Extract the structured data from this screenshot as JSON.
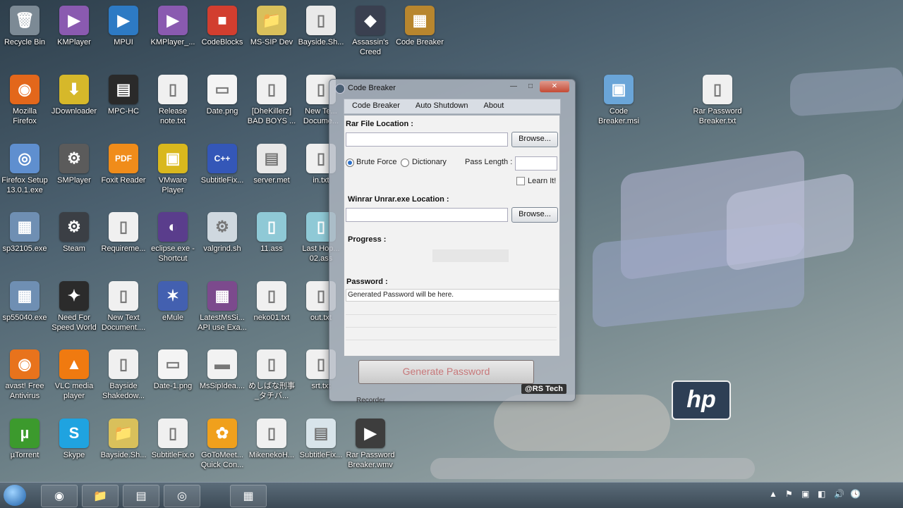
{
  "desktop_icons": [
    {
      "label": "Recycle Bin",
      "icon": "recycle-bin-icon",
      "color": "#7c8a95",
      "glyph": "🗑"
    },
    {
      "label": "KMPlayer",
      "icon": "kmplayer-icon",
      "color": "#8a5ab0",
      "glyph": "▶"
    },
    {
      "label": "MPUI",
      "icon": "mpui-icon",
      "color": "#2d7ac4",
      "glyph": "▶"
    },
    {
      "label": "KMPlayer_...",
      "icon": "kmplayer-icon",
      "color": "#8a5ab0",
      "glyph": "▶"
    },
    {
      "label": "CodeBlocks",
      "icon": "codeblocks-icon",
      "color": "#d23e2f",
      "glyph": "■"
    },
    {
      "label": "MS-SIP Dev",
      "icon": "folder-icon",
      "color": "#d9c05b",
      "glyph": "📁"
    },
    {
      "label": "Bayside.Sh...",
      "icon": "file-icon",
      "color": "#e9e9e9",
      "glyph": "▯"
    },
    {
      "label": "Assassin's Creed",
      "icon": "assassins-creed-icon",
      "color": "#3a4050",
      "glyph": "◆"
    },
    {
      "label": "Code Breaker",
      "icon": "winrar-icon",
      "color": "#b8862e",
      "glyph": "▦"
    },
    {
      "label": "Mozilla Firefox",
      "icon": "firefox-icon",
      "color": "#e3671b",
      "glyph": "◉"
    },
    {
      "label": "JDownloader",
      "icon": "jdownloader-icon",
      "color": "#d6b82a",
      "glyph": "⬇"
    },
    {
      "label": "MPC-HC",
      "icon": "mpc-hc-icon",
      "color": "#2a2a2a",
      "glyph": "▤"
    },
    {
      "label": "Release note.txt",
      "icon": "text-file-icon",
      "color": "#f0f0f0",
      "glyph": "▯"
    },
    {
      "label": "Date.png",
      "icon": "image-file-icon",
      "color": "#f4f4f4",
      "glyph": "▭"
    },
    {
      "label": "[DheKillerz] BAD BOYS ...",
      "icon": "file-icon",
      "color": "#f0f0f0",
      "glyph": "▯"
    },
    {
      "label": "New Te... Docume...",
      "icon": "text-file-icon",
      "color": "#f0f0f0",
      "glyph": "▯"
    },
    {
      "label": "Firefox Setup 13.0.1.exe",
      "icon": "installer-icon",
      "color": "#5f8fcf",
      "glyph": "◎"
    },
    {
      "label": "SMPlayer",
      "icon": "smplayer-icon",
      "color": "#5b5b5b",
      "glyph": "⚙"
    },
    {
      "label": "Foxit Reader",
      "icon": "foxit-reader-icon",
      "color": "#f08c1a",
      "glyph": "PDF"
    },
    {
      "label": "VMware Player",
      "icon": "vmware-icon",
      "color": "#d9b81d",
      "glyph": "▣"
    },
    {
      "label": "SubtitleFix...",
      "icon": "subtitle-fix-icon",
      "color": "#3457b8",
      "glyph": "C++"
    },
    {
      "label": "server.met",
      "icon": "server-file-icon",
      "color": "#e8e8e8",
      "glyph": "▤"
    },
    {
      "label": "in.txt",
      "icon": "text-file-icon",
      "color": "#f0f0f0",
      "glyph": "▯"
    },
    {
      "label": "sp32105.exe",
      "icon": "exe-icon",
      "color": "#6f8fb3",
      "glyph": "▦"
    },
    {
      "label": "Steam",
      "icon": "steam-icon",
      "color": "#3b3f45",
      "glyph": "⚙"
    },
    {
      "label": "Requireme...",
      "icon": "text-file-icon",
      "color": "#f0f0f0",
      "glyph": "▯"
    },
    {
      "label": "eclipse.exe - Shortcut",
      "icon": "eclipse-icon",
      "color": "#5a3d8c",
      "glyph": "◐"
    },
    {
      "label": "valgrind.sh",
      "icon": "script-icon",
      "color": "#cfd8df",
      "glyph": "⚙"
    },
    {
      "label": "11.ass",
      "icon": "subtitle-file-icon",
      "color": "#8fc9d6",
      "glyph": "▯"
    },
    {
      "label": "Last Hop... 02.ass",
      "icon": "subtitle-file-icon",
      "color": "#8fc9d6",
      "glyph": "▯"
    },
    {
      "label": "sp55040.exe",
      "icon": "exe-icon",
      "color": "#6f8fb3",
      "glyph": "▦"
    },
    {
      "label": "Need For Speed World",
      "icon": "nfs-icon",
      "color": "#2b2b2b",
      "glyph": "✦"
    },
    {
      "label": "New Text Document....",
      "icon": "text-file-icon",
      "color": "#f0f0f0",
      "glyph": "▯"
    },
    {
      "label": "eMule",
      "icon": "emule-icon",
      "color": "#4360b0",
      "glyph": "✶"
    },
    {
      "label": "LatestMsSi... API use Exa...",
      "icon": "winrar-icon",
      "color": "#7c4a8d",
      "glyph": "▦"
    },
    {
      "label": "neko01.txt",
      "icon": "text-file-icon",
      "color": "#f0f0f0",
      "glyph": "▯"
    },
    {
      "label": "out.txt",
      "icon": "text-file-icon",
      "color": "#f0f0f0",
      "glyph": "▯"
    },
    {
      "label": "avast! Free Antivirus",
      "icon": "avast-icon",
      "color": "#e8731c",
      "glyph": "◉"
    },
    {
      "label": "VLC media player",
      "icon": "vlc-icon",
      "color": "#f07a10",
      "glyph": "▲"
    },
    {
      "label": "Bayside Shakedow...",
      "icon": "file-icon",
      "color": "#f0f0f0",
      "glyph": "▯"
    },
    {
      "label": "Date-1.png",
      "icon": "image-file-icon",
      "color": "#f4f4f4",
      "glyph": "▭"
    },
    {
      "label": "MsSipIdea....",
      "icon": "document-icon",
      "color": "#f2f2f2",
      "glyph": "▬"
    },
    {
      "label": "めしばな刑事_タチバ...",
      "icon": "file-icon",
      "color": "#f0f0f0",
      "glyph": "▯"
    },
    {
      "label": "srt.txt",
      "icon": "text-file-icon",
      "color": "#f0f0f0",
      "glyph": "▯"
    },
    {
      "label": "µTorrent",
      "icon": "utorrent-icon",
      "color": "#3c9a2d",
      "glyph": "µ"
    },
    {
      "label": "Skype",
      "icon": "skype-icon",
      "color": "#1fa3e0",
      "glyph": "S"
    },
    {
      "label": "Bayside.Sh...",
      "icon": "folder-icon",
      "color": "#d9c05b",
      "glyph": "📁"
    },
    {
      "label": "SubtitleFix.o",
      "icon": "file-icon",
      "color": "#f0f0f0",
      "glyph": "▯"
    },
    {
      "label": "GoToMeet... Quick Con...",
      "icon": "gotomeeting-icon",
      "color": "#f0a01c",
      "glyph": "✿"
    },
    {
      "label": "MikenekoH...",
      "icon": "file-icon",
      "color": "#f0f0f0",
      "glyph": "▯"
    },
    {
      "label": "SubtitleFix...",
      "icon": "window-icon",
      "color": "#d8e4ea",
      "glyph": "▤"
    },
    {
      "label": "Rar Password Breaker.wmv",
      "icon": "video-file-icon",
      "color": "#3d3d3d",
      "glyph": "▶"
    },
    {
      "label": "Code Breaker.msi",
      "icon": "msi-icon",
      "color": "#6aa5d8",
      "glyph": "▣"
    },
    {
      "label": "Rar Password Breaker.txt",
      "icon": "text-file-icon",
      "color": "#f0f0f0",
      "glyph": "▯"
    }
  ],
  "app": {
    "title": "Code Breaker",
    "menu": [
      "Code Breaker",
      "Auto Shutdown",
      "About"
    ],
    "rar_file_location_label": "Rar File Location :",
    "browse_label": "Browse...",
    "brute_force_label": "Brute Force",
    "dictionary_label": "Dictionary",
    "pass_length_label": "Pass Length :",
    "learn_it_label": "Learn It!",
    "winrar_location_label": "Winrar Unrar.exe Location :",
    "progress_label": "Progress :",
    "password_label": "Password :",
    "password_value": "Generated Password will be here.",
    "generate_button": "Generate Password",
    "brand": "@RS Tech",
    "under_label": "Recorder",
    "minimize": "—",
    "maximize": "□",
    "close": "✕"
  },
  "taskbar": {
    "items": [
      "firefox-icon",
      "explorer-icon",
      "app-icon",
      "target-icon",
      "winrar-icon"
    ],
    "tray": [
      "▲",
      "⚑",
      "▣",
      "◧",
      "🔊",
      "🕓"
    ]
  },
  "hp_logo": "hp"
}
